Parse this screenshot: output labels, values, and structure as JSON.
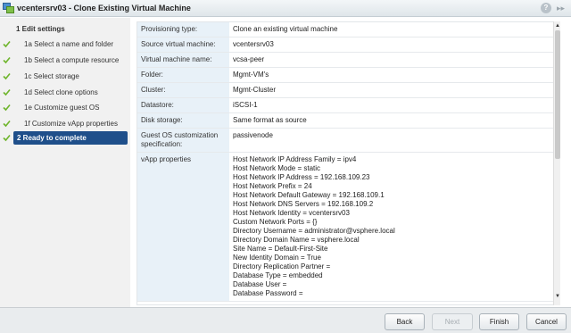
{
  "window": {
    "title": "vcentersrv03 - Clone Existing Virtual Machine",
    "help_label": "?",
    "expand_label": "▸▸"
  },
  "sidebar": {
    "steps": [
      {
        "label": "1 Edit settings",
        "done": false,
        "active": false,
        "heading": true
      },
      {
        "label": "1a  Select a name and folder",
        "done": true
      },
      {
        "label": "1b  Select a compute resource",
        "done": true
      },
      {
        "label": "1c  Select storage",
        "done": true
      },
      {
        "label": "1d  Select clone options",
        "done": true
      },
      {
        "label": "1e  Customize guest OS",
        "done": true
      },
      {
        "label": "1f  Customize vApp properties",
        "done": true
      },
      {
        "label": "2  Ready to complete",
        "done": true,
        "active": true
      }
    ]
  },
  "summary": {
    "rows": [
      {
        "key": "Provisioning type:",
        "value": "Clone an existing virtual machine"
      },
      {
        "key": "Source virtual machine:",
        "value": "vcentersrv03"
      },
      {
        "key": "Virtual machine name:",
        "value": "vcsa-peer"
      },
      {
        "key": "Folder:",
        "value": "Mgmt-VM's"
      },
      {
        "key": "Cluster:",
        "value": "Mgmt-Cluster"
      },
      {
        "key": "Datastore:",
        "value": "iSCSI-1"
      },
      {
        "key": "Disk storage:",
        "value": "Same format as source"
      },
      {
        "key": "Guest OS customization specification:",
        "value": "passivenode"
      }
    ],
    "vapp_key": "vApp properties",
    "vapp_lines": [
      "Host Network IP Address Family = ipv4",
      "Host Network Mode = static",
      "Host Network IP Address = 192.168.109.23",
      "Host Network Prefix = 24",
      "Host Network Default Gateway = 192.168.109.1",
      "Host Network DNS Servers = 192.168.109.2",
      "Host Network Identity = vcentersrv03",
      "Custom Network Ports = {}",
      "Directory Username = administrator@vsphere.local",
      "Directory Domain Name = vsphere.local",
      "Site Name = Default-First-Site",
      "New Identity Domain = True",
      "Directory Replication Partner =",
      "Database Type = embedded",
      "Database User =",
      "Database Password ="
    ]
  },
  "footer": {
    "back_label": "Back",
    "next_label": "Next",
    "finish_label": "Finish",
    "cancel_label": "Cancel"
  },
  "colors": {
    "active_step": "#1f4f8a",
    "check": "#6fb52c",
    "key_cell": "#e8f1f8"
  }
}
